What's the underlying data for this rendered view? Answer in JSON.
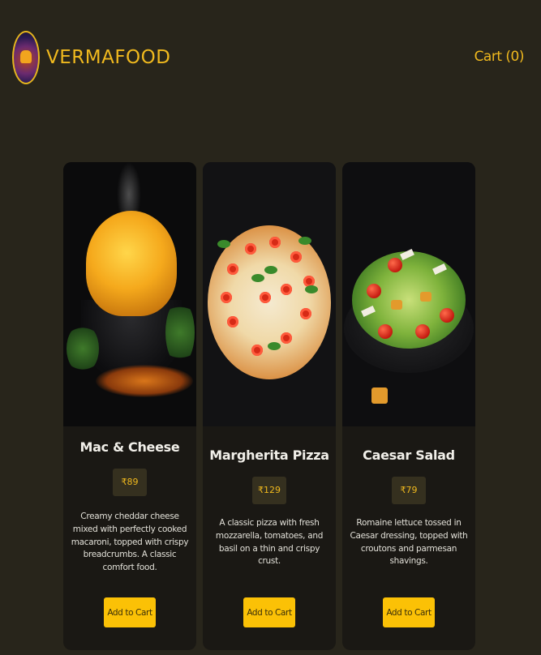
{
  "header": {
    "brand": "VERMAFOOD",
    "cart_label": "Cart (0)"
  },
  "products": [
    {
      "name": "Mac & Cheese",
      "price": "₹89",
      "description": "Creamy cheddar cheese mixed with perfectly cooked macaroni, topped with crispy breadcrumbs. A classic comfort food.",
      "button": "Add to Cart"
    },
    {
      "name": "Margherita Pizza",
      "price": "₹129",
      "description": "A classic pizza with fresh mozzarella, tomatoes, and basil on a thin and crispy crust.",
      "button": "Add to Cart"
    },
    {
      "name": "Caesar Salad",
      "price": "₹79",
      "description": "Romaine lettuce tossed in Caesar dressing, topped with croutons and parmesan shavings.",
      "button": "Add to Cart"
    }
  ],
  "colors": {
    "background": "#28251b",
    "accent": "#f0b91e",
    "card": "#1a1814",
    "button": "#fbc106"
  }
}
